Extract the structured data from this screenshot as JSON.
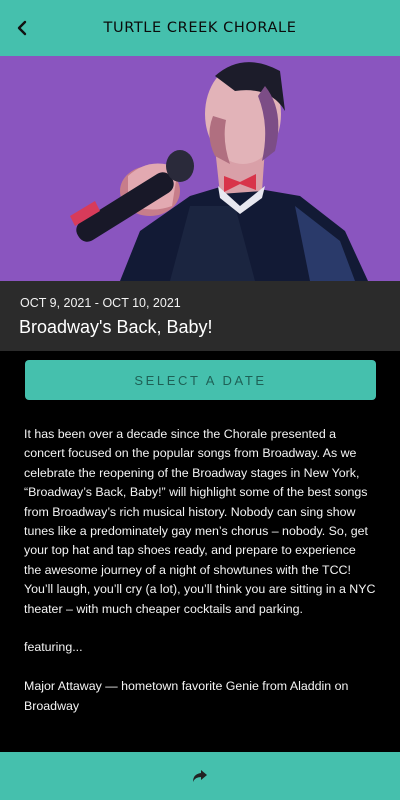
{
  "header": {
    "title": "TURTLE CREEK CHORALE",
    "back_icon": "chevron-left-icon"
  },
  "event": {
    "dates": "OCT 9, 2021 - OCT 10, 2021",
    "title": "Broadway's Back, Baby!",
    "select_button_label": "SELECT A DATE",
    "description": "It has been over a decade since the Chorale presented a concert focused on the popular songs from Broadway. As we celebrate the reopening of the Broadway stages in New York, “Broadway’s Back, Baby!” will highlight some of the best songs from Broadway’s rich musical history. Nobody can sing show tunes like a predominately gay men’s chorus – nobody. So, get your top hat and tap shoes ready, and prepare to experience the awesome journey of a night of showtunes with the TCC! You’ll laugh, you’ll cry (a lot), you’ll think you are sitting in a NYC theater – with much cheaper cocktails and parking.",
    "featuring_label": "featuring...",
    "featured_performer": "Major Attaway — hometown favorite Genie from Aladdin on Broadway"
  },
  "footer": {
    "share_icon": "share-arrow-icon"
  },
  "colors": {
    "accent": "#45c0ad",
    "hero_background": "#8a55bf",
    "info_bar": "#2b2b2b",
    "page_background": "#000000"
  }
}
